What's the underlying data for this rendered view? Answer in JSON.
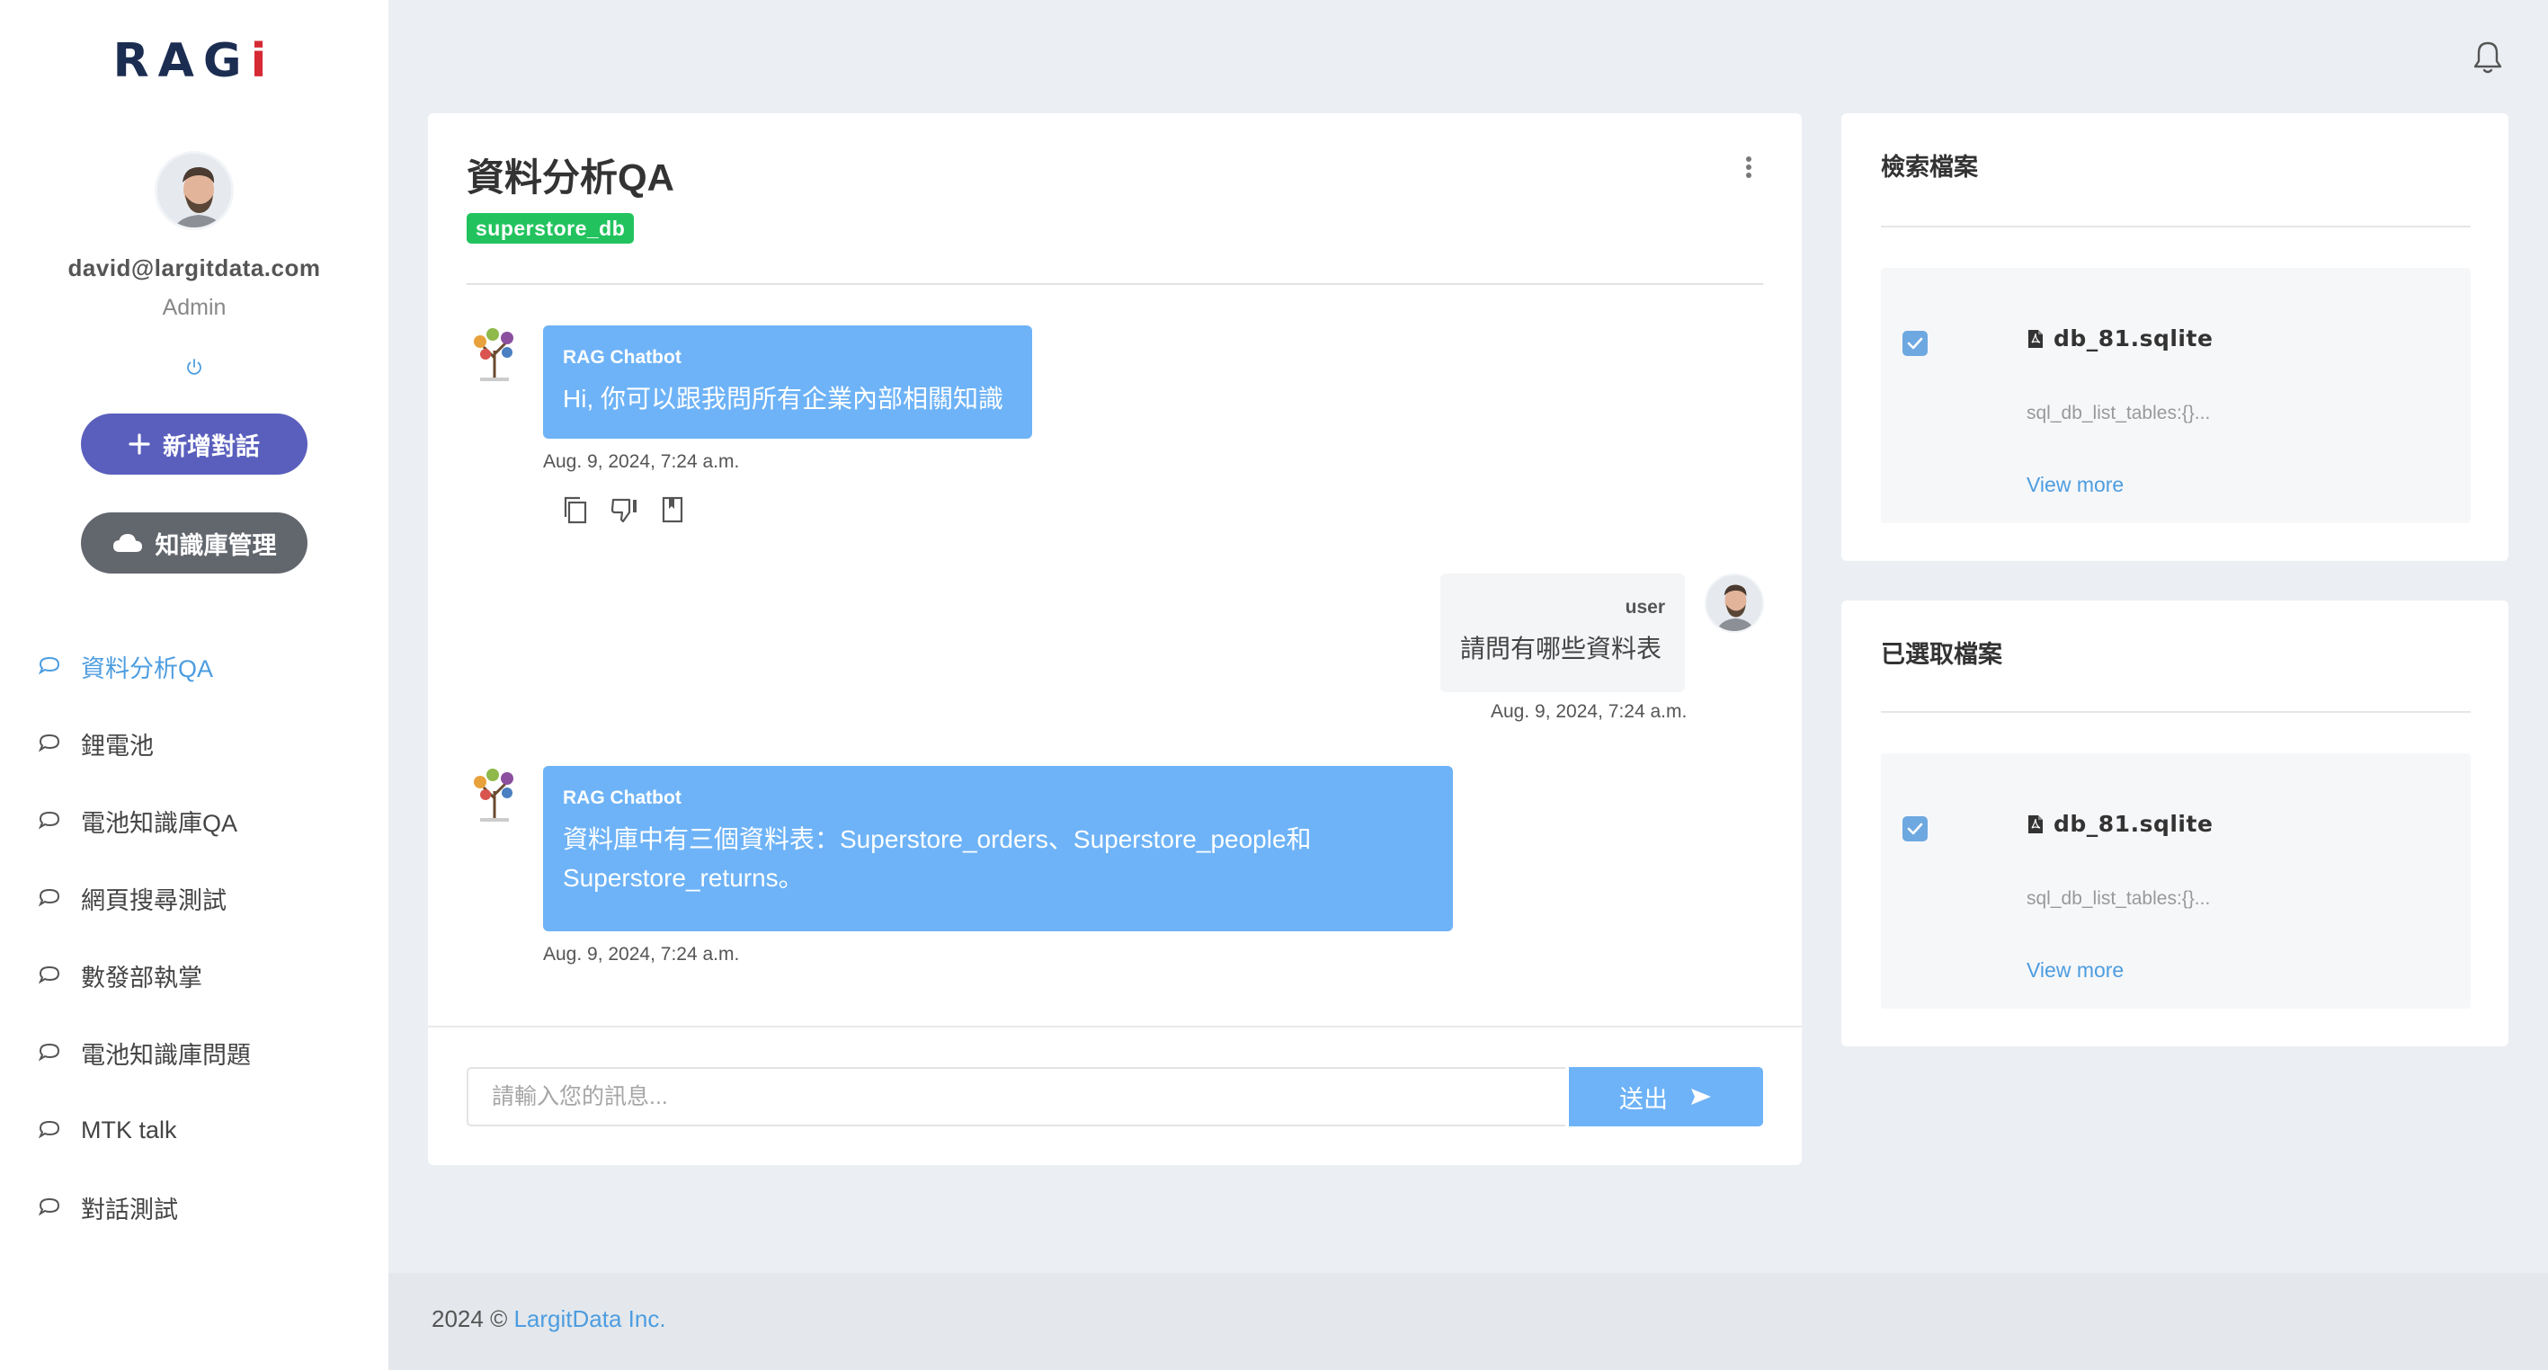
{
  "sidebar": {
    "logo": {
      "part1": "R",
      "part2": "A",
      "part3": "G",
      "part4": "i"
    },
    "user_email": "david@largitdata.com",
    "user_role": "Admin",
    "new_chat_label": "新增對話",
    "kb_label": "知識庫管理",
    "items": [
      {
        "label": "資料分析QA",
        "active": true
      },
      {
        "label": "鋰電池"
      },
      {
        "label": "電池知識庫QA"
      },
      {
        "label": "網頁搜尋測試"
      },
      {
        "label": "數發部執掌"
      },
      {
        "label": "電池知識庫問題"
      },
      {
        "label": "MTK talk"
      },
      {
        "label": "對話測試"
      }
    ]
  },
  "chat": {
    "title": "資料分析QA",
    "db_tag": "superstore_db",
    "messages": [
      {
        "sender": "RAG Chatbot",
        "text": "Hi, 你可以跟我問所有企業內部相關知識",
        "time": "Aug. 9, 2024, 7:24 a.m."
      },
      {
        "sender": "user",
        "text": "請問有哪些資料表",
        "time": "Aug. 9, 2024, 7:24 a.m."
      },
      {
        "sender": "RAG Chatbot",
        "text_line1": "資料庫中有三個資料表：Superstore_orders、Superstore_people和",
        "text_line2": "Superstore_returns。",
        "time": "Aug. 9, 2024, 7:24 a.m."
      }
    ],
    "input_placeholder": "請輸入您的訊息...",
    "send_label": "送出"
  },
  "panels": {
    "retrieved": {
      "title": "檢索檔案",
      "file": {
        "name": "db_81.sqlite",
        "desc": "sql_db_list_tables:{}...",
        "more": "View more",
        "checked": true
      }
    },
    "selected": {
      "title": "已選取檔案",
      "file": {
        "name": "db_81.sqlite",
        "desc": "sql_db_list_tables:{}...",
        "more": "View more",
        "checked": true
      }
    }
  },
  "footer": {
    "text": "2024 © ",
    "link": "LargitData Inc."
  },
  "colors": {
    "accent": "#4d9de0",
    "bubble": "#6eb3f7",
    "new_button": "#5a5fbd",
    "tag": "#22c35e"
  }
}
